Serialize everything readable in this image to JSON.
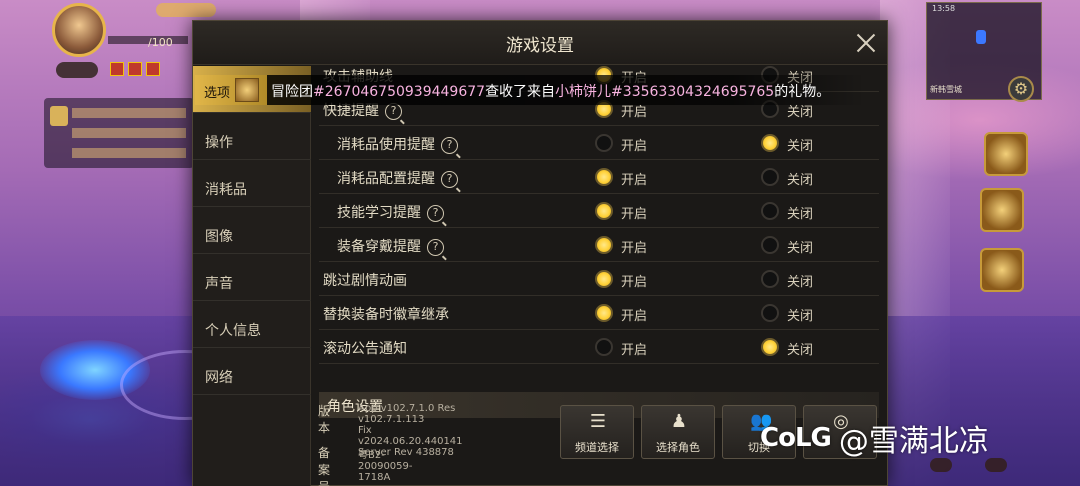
{
  "hud": {
    "hp_text": "/100",
    "minimap_time": "13:58",
    "minimap_location": "新韩雪城"
  },
  "dialog": {
    "title": "游戏设置"
  },
  "sidebar": {
    "items": [
      {
        "label": "选项",
        "active": true
      },
      {
        "label": "操作"
      },
      {
        "label": "消耗品"
      },
      {
        "label": "图像"
      },
      {
        "label": "声音"
      },
      {
        "label": "个人信息"
      },
      {
        "label": "网络"
      }
    ]
  },
  "options": {
    "on_label": "开启",
    "off_label": "关闭",
    "rows": [
      {
        "label": "攻击辅助线",
        "help": false,
        "indent": false,
        "value": "on"
      },
      {
        "label": "快捷提醒",
        "help": true,
        "indent": false,
        "value": "on"
      },
      {
        "label": "消耗品使用提醒",
        "help": true,
        "indent": true,
        "value": "off"
      },
      {
        "label": "消耗品配置提醒",
        "help": true,
        "indent": true,
        "value": "on"
      },
      {
        "label": "技能学习提醒",
        "help": true,
        "indent": true,
        "value": "on"
      },
      {
        "label": "装备穿戴提醒",
        "help": true,
        "indent": true,
        "value": "on"
      },
      {
        "label": "跳过剧情动画",
        "help": false,
        "indent": false,
        "value": "on"
      },
      {
        "label": "替换装备时徽章继承",
        "help": false,
        "indent": false,
        "value": "on"
      },
      {
        "label": "滚动公告通知",
        "help": false,
        "indent": false,
        "value": "off"
      }
    ]
  },
  "section": {
    "title": "角色设置"
  },
  "footer": {
    "version_label": "版本",
    "version_text": "App v102.7.1.0 Res v102.7.1.113\nFix v2024.06.20.440141\nServer Rev 438878",
    "icp_label": "备案号",
    "icp_text": "粤B2-20090059-1718A",
    "buttons": [
      {
        "label": "频道选择",
        "icon": "list-icon"
      },
      {
        "label": "选择角色",
        "icon": "character-icon"
      },
      {
        "label": "切换",
        "icon": "switch-account-icon"
      },
      {
        "label": "",
        "icon": "support-icon"
      }
    ]
  },
  "notification": {
    "tag": "选项",
    "text_prefix": "冒险团",
    "team_id": "#267046750939449677",
    "text_middle": "查收了来自",
    "sender": "小柿饼儿#335633043246957​65",
    "text_suffix": "的礼物。"
  },
  "watermark": {
    "logo": "CoLG",
    "handle": "@雪满北凉"
  },
  "colors": {
    "accent_gold": "#ffd23a",
    "highlight_pink": "#f8b3e0",
    "panel_bg": "#1b1917"
  }
}
